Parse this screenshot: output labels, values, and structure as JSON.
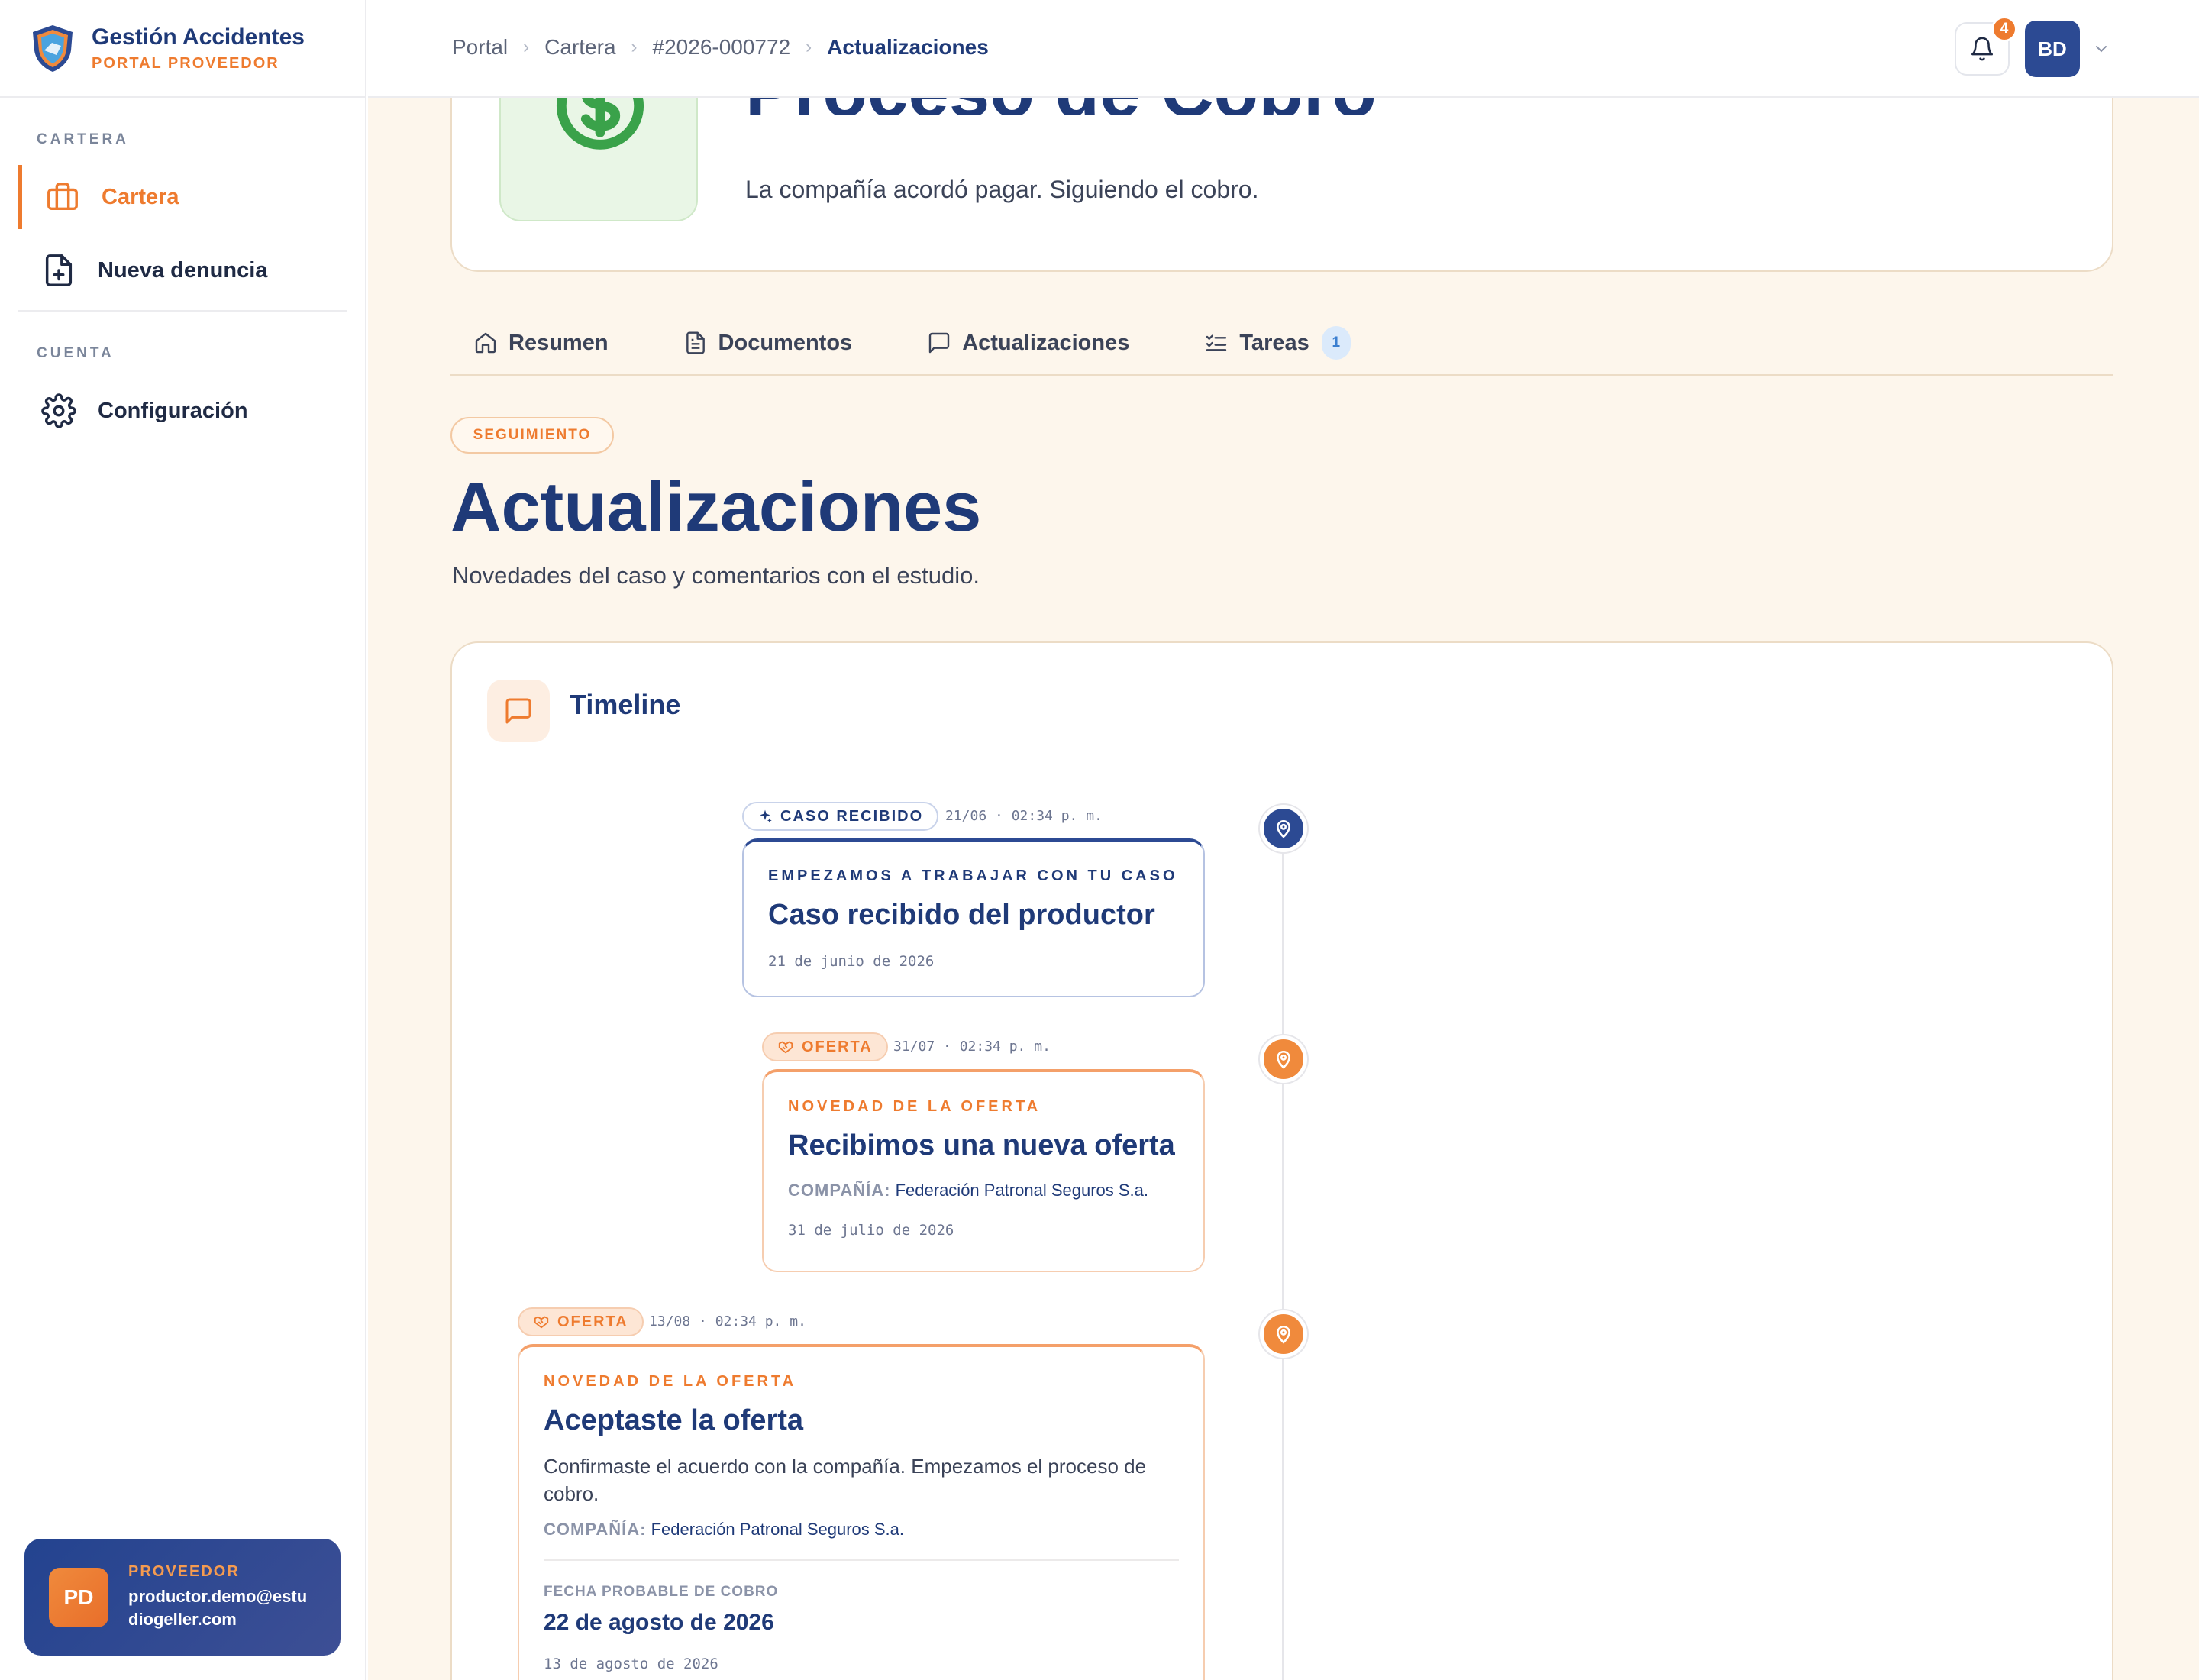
{
  "brand": {
    "name": "Gestión Accidentes",
    "sub": "PORTAL PROVEEDOR"
  },
  "sidebar": {
    "section_cartera": "CARTERA",
    "items": [
      {
        "label": "Cartera"
      },
      {
        "label": "Nueva denuncia"
      }
    ],
    "section_cuenta": "CUENTA",
    "config": "Configuración"
  },
  "profile": {
    "initials": "PD",
    "role": "PROVEEDOR",
    "email": "productor.demo@estudiogeller.com"
  },
  "breadcrumb": [
    "Portal",
    "Cartera",
    "#2026-000772",
    "Actualizaciones"
  ],
  "topbar": {
    "notif_count": "4",
    "user_initials": "BD"
  },
  "hero": {
    "title": "Proceso de Cobro",
    "description": "La compañía acordó pagar. Siguiendo el cobro."
  },
  "tabs": [
    {
      "label": "Resumen"
    },
    {
      "label": "Documentos"
    },
    {
      "label": "Actualizaciones"
    },
    {
      "label": "Tareas",
      "count": "1"
    }
  ],
  "section": {
    "pill": "SEGUIMIENTO",
    "title": "Actualizaciones",
    "subtitle": "Novedades del caso y comentarios con el estudio."
  },
  "timeline": {
    "title": "Timeline",
    "events": [
      {
        "tag": "CASO RECIBIDO",
        "time": "21/06 · 02:34 p. m.",
        "kicker": "EMPEZAMOS A TRABAJAR CON TU CASO",
        "heading": "Caso recibido del productor",
        "date": "21 de junio de 2026"
      },
      {
        "tag": "OFERTA",
        "time": "31/07 · 02:34 p. m.",
        "kicker": "NOVEDAD DE LA OFERTA",
        "heading": "Recibimos una nueva oferta",
        "company_label": "COMPAÑÍA:",
        "company": "Federación Patronal Seguros S.a.",
        "date": "31 de julio de 2026"
      },
      {
        "tag": "OFERTA",
        "time": "13/08 · 02:34 p. m.",
        "kicker": "NOVEDAD DE LA OFERTA",
        "heading": "Aceptaste la oferta",
        "body": "Confirmaste el acuerdo con la compañía. Empezamos el proceso de cobro.",
        "company_label": "COMPAÑÍA:",
        "company": "Federación Patronal Seguros S.a.",
        "payment_label": "FECHA PROBABLE DE COBRO",
        "payment_date": "22 de agosto de 2026",
        "date": "13 de agosto de 2026"
      }
    ]
  },
  "colors": {
    "primary": "#1f3a78",
    "accent": "#ee7b2f",
    "background": "#fdf6ec",
    "success": "#3aa24a"
  }
}
